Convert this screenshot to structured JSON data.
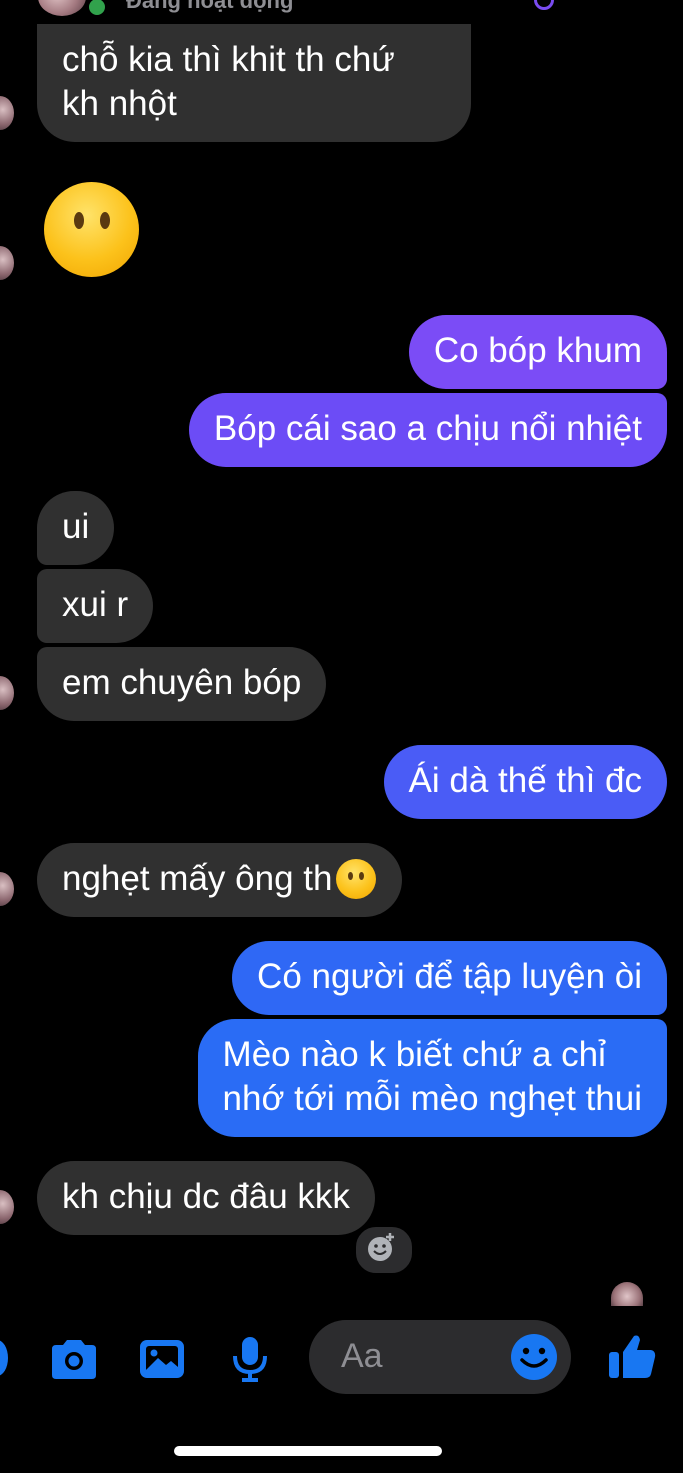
{
  "header": {
    "status_text": "Đang hoạt động"
  },
  "messages": [
    {
      "id": 1,
      "side": "incoming",
      "lines": [
        "chỗ kia thì khit th chứ",
        "kh nhột"
      ]
    },
    {
      "id": 2,
      "side": "incoming",
      "type": "emoji",
      "emoji": "face-without-mouth"
    },
    {
      "id": 3,
      "side": "outgoing",
      "text": "Co bóp khum",
      "color": "#7b4cf6"
    },
    {
      "id": 4,
      "side": "outgoing",
      "text": "Bóp cái sao a chịu nổi nhiệt",
      "color": "#6c4cf6"
    },
    {
      "id": 5,
      "side": "incoming",
      "text": "ui"
    },
    {
      "id": 6,
      "side": "incoming",
      "text": "xui r"
    },
    {
      "id": 7,
      "side": "incoming",
      "text": "em chuyên bóp"
    },
    {
      "id": 8,
      "side": "outgoing",
      "text": "Ái dà thế thì đc",
      "color": "#4a5cf6"
    },
    {
      "id": 9,
      "side": "incoming",
      "text": "nghẹt mấy ông th",
      "trailing_emoji": "face-without-mouth"
    },
    {
      "id": 10,
      "side": "outgoing",
      "text": "Có người để tập luyện òi",
      "color": "#2f68f5"
    },
    {
      "id": 11,
      "side": "outgoing",
      "lines": [
        "Mèo nào k biết chứ a chỉ",
        "nhớ tới mỗi mèo nghẹt thui"
      ],
      "color": "#2a6cf5"
    },
    {
      "id": 12,
      "side": "incoming",
      "text": "kh chịu dc đâu kkk"
    }
  ],
  "reaction_button": {
    "icon": "add-reaction-icon"
  },
  "composer": {
    "placeholder": "Aa",
    "icons": [
      "more-icon",
      "camera-icon",
      "gallery-icon",
      "microphone-icon",
      "emoji-icon",
      "thumbs-up-icon"
    ],
    "accent": "#1877f2"
  },
  "colors": {
    "incoming_bubble": "#303030",
    "background": "#000000"
  }
}
